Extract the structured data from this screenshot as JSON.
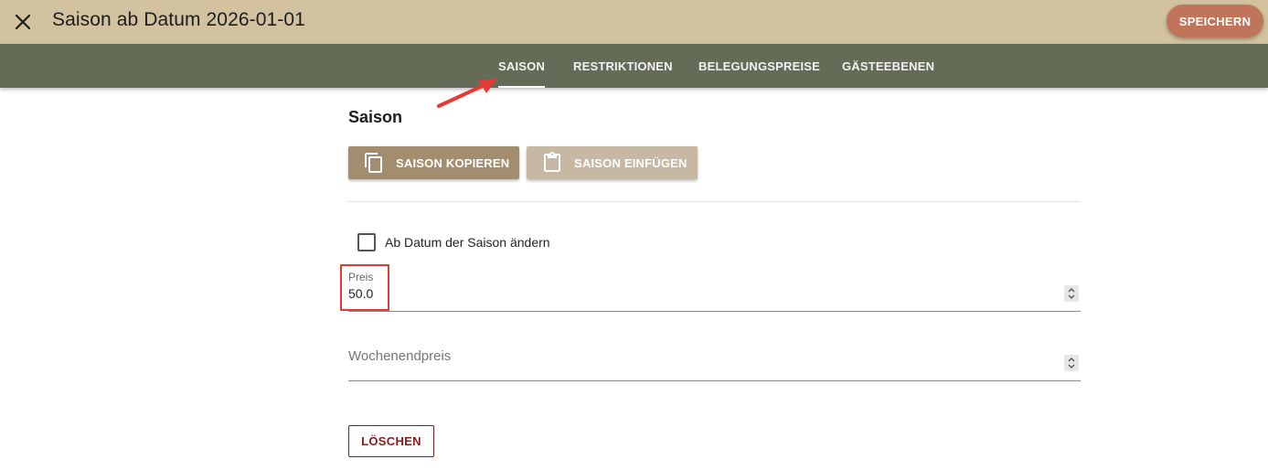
{
  "header": {
    "title": "Saison ab Datum 2026-01-01",
    "save_label": "SPEICHERN",
    "close_icon": "close-icon"
  },
  "tabs": [
    {
      "label": "SAISON",
      "active": true
    },
    {
      "label": "RESTRIKTIONEN",
      "active": false
    },
    {
      "label": "BELEGUNGSPREISE",
      "active": false
    },
    {
      "label": "GÄSTEEBENEN",
      "active": false
    }
  ],
  "section": {
    "title": "Saison",
    "copy_label": "SAISON KOPIEREN",
    "copy_icon": "copy-icon",
    "paste_label": "SAISON EINFÜGEN",
    "paste_icon": "clipboard-icon"
  },
  "form": {
    "change_date_label": "Ab Datum der Saison ändern",
    "change_date_checked": false,
    "price_label": "Preis",
    "price_value": "50.0",
    "weekend_price_label": "Wochenendpreis",
    "weekend_price_value": ""
  },
  "actions": {
    "delete_label": "LÖSCHEN"
  },
  "colors": {
    "header_bg": "#d2c29f",
    "tabbar_bg": "#646b56",
    "save_button": "#c0745a",
    "copy_button": "#a28e6e",
    "paste_button": "#c6b8a2",
    "delete_text": "#8b1a1a",
    "annotation": "#e53935"
  }
}
